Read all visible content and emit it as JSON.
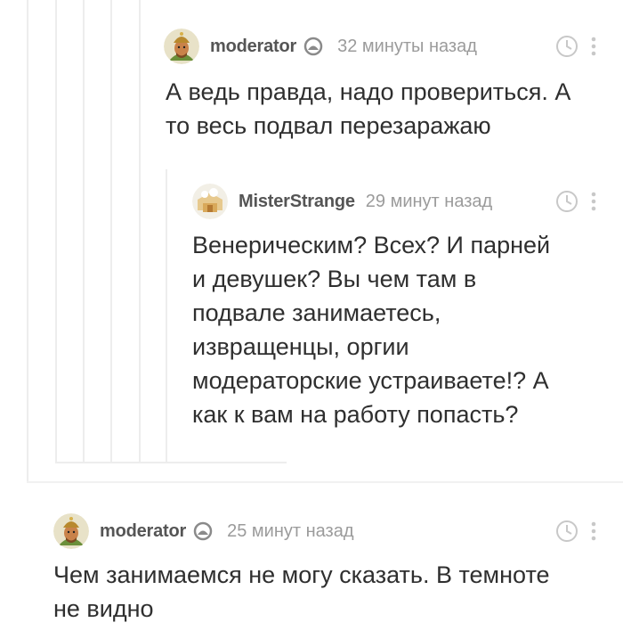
{
  "comments": [
    {
      "author": "moderator",
      "time": "32 минуты назад",
      "text": "А ведь правда, надо провериться. А\nто весь подвал перезаражаю",
      "avatar": "moderator-avatar",
      "role_icon": "moderator-shield-icon"
    },
    {
      "author": "MisterStrange",
      "time": "29 минут назад",
      "text": "Венерическим? Всех? И парней\nи девушек? Вы чем там в\nподвале занимаетесь,\nизвращенцы, оргии\nмодераторские устраиваете!? А\nкак к вам на работу попасть?",
      "avatar": "misterstrange-avatar"
    },
    {
      "author": "moderator",
      "time": "25 минут назад",
      "text": "Чем занимаемся не могу сказать. В темноте\nне видно",
      "avatar": "moderator-avatar",
      "role_icon": "moderator-shield-icon"
    }
  ],
  "colors": {
    "thread_line": "#ededed",
    "nick": "#555555",
    "time": "#9b9b9b",
    "text": "#2f2f2f",
    "icon": "#c8c8c8"
  }
}
